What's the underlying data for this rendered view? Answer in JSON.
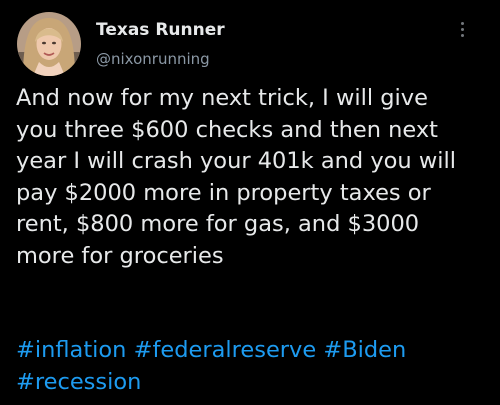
{
  "user": {
    "display_name": "Texas Runner",
    "handle": "@nixonrunning"
  },
  "tweet": {
    "lines": [
      "And now for my next trick, I will give",
      "you three $600 checks and then next",
      "year I will crash your 401k and you will",
      "pay $2000 more in property taxes or",
      "rent, $800 more for gas, and $3000",
      "more for groceries"
    ],
    "hashtags": [
      "#inflation",
      "#federalreserve",
      "#Biden",
      "#recession"
    ]
  },
  "icons": {
    "avatar": "profile-photo",
    "more": "more-options-icon"
  },
  "colors": {
    "background": "#000000",
    "text": "#e7e9ea",
    "secondary_text": "#8b98a5",
    "link": "#1d9bf0"
  }
}
